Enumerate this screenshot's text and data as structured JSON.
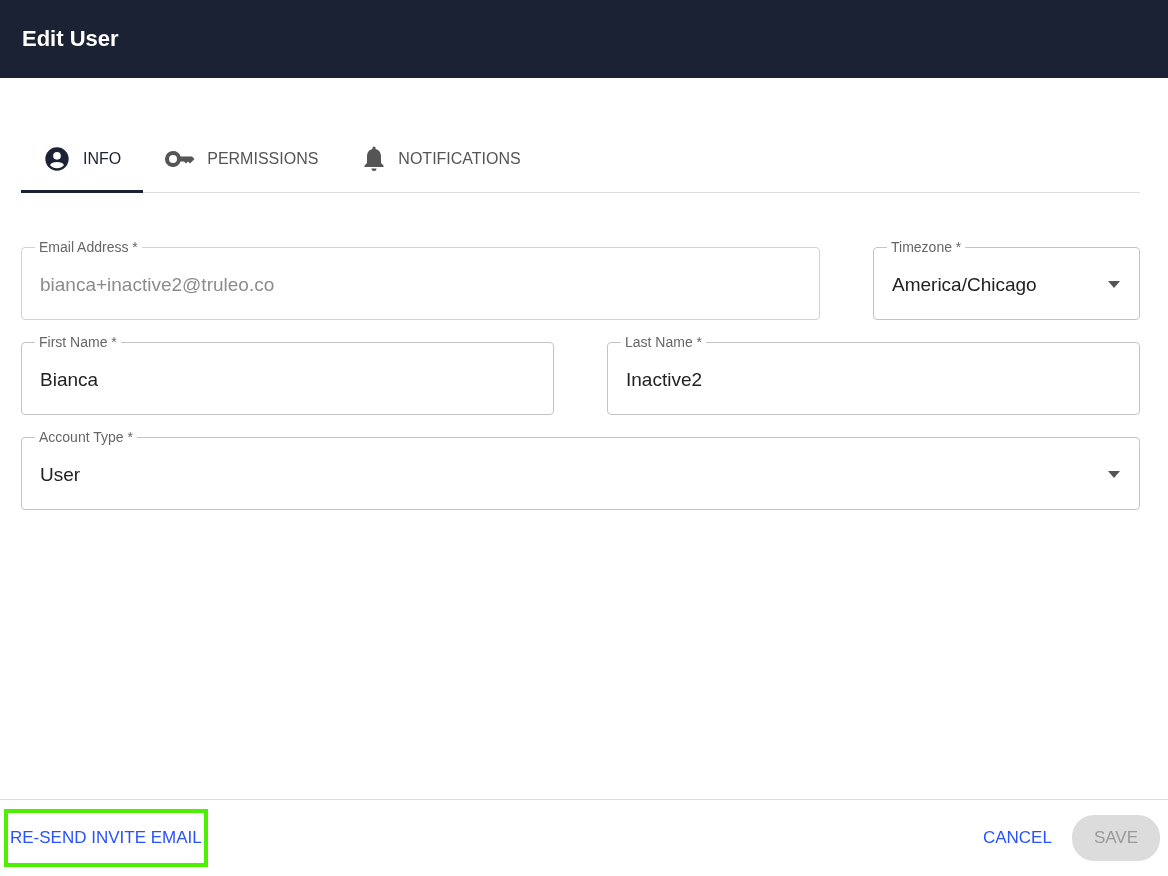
{
  "window": {
    "title": "Edit User"
  },
  "tabs": [
    {
      "label": "INFO",
      "selected": true
    },
    {
      "label": "PERMISSIONS",
      "selected": false
    },
    {
      "label": "NOTIFICATIONS",
      "selected": false
    }
  ],
  "form_rows": [
    [
      {
        "label": "Email Address *",
        "kind": "text",
        "value": "bianca+inactive2@truleo.co",
        "disabled": true
      },
      {
        "label": "Timezone *",
        "kind": "select",
        "value": "America/Chicago",
        "disabled": false
      }
    ],
    [
      {
        "label": "First Name *",
        "kind": "text",
        "value": "Bianca",
        "disabled": false
      },
      {
        "label": "Last Name *",
        "kind": "text",
        "value": "Inactive2",
        "disabled": false
      }
    ],
    [
      {
        "label": "Account Type *",
        "kind": "select",
        "value": "User",
        "disabled": false
      }
    ]
  ],
  "footer": {
    "resend": {
      "label": "RE-SEND INVITE EMAIL",
      "highlighted": true
    },
    "cancel": {
      "label": "CANCEL"
    },
    "save": {
      "label": "SAVE",
      "disabled": true
    }
  }
}
